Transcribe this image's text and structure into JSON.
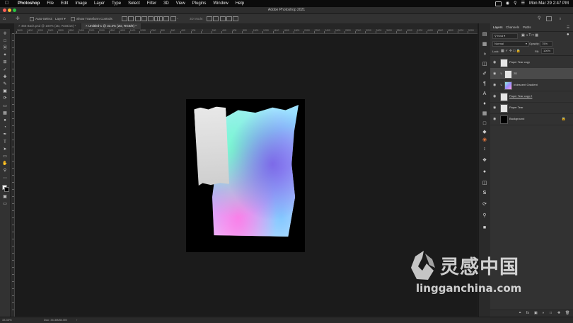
{
  "menubar": {
    "app": "Photoshop",
    "menus": [
      "File",
      "Edit",
      "Image",
      "Layer",
      "Type",
      "Select",
      "Filter",
      "3D",
      "View",
      "Plugins",
      "Window",
      "Help"
    ],
    "clock": "Mon Mar 29  2:47 PM"
  },
  "titlebar": {
    "title": "Adobe Photoshop 2021"
  },
  "options": {
    "auto_select": "Auto-Select:",
    "auto_select_target": "Layer",
    "transform_controls": "Show Transform Controls",
    "mode_3d": "3D Mode:"
  },
  "tabs": [
    {
      "label": "456 Back.psd @ 100% (2D, RGB/16) *"
    },
    {
      "label": "Untitled-1 @ 33.3% (2D, RGB/8) *"
    }
  ],
  "ruler": {
    "labels": [
      "3600",
      "3400",
      "3200",
      "3000",
      "2800",
      "2600",
      "2400",
      "2200",
      "2000",
      "1800",
      "1600",
      "1400",
      "1200",
      "1000",
      "800",
      "600",
      "400",
      "200",
      "0",
      "200",
      "400",
      "600",
      "800",
      "1000",
      "1200",
      "1400",
      "1600",
      "1800",
      "2000",
      "2200",
      "2400",
      "2600",
      "2800",
      "3000",
      "3200",
      "3400",
      "3600",
      "3800",
      "4000",
      "4200",
      "4400",
      "4600",
      "4800",
      "5000",
      "5200",
      "5400"
    ]
  },
  "panel": {
    "tabs": [
      "Layers",
      "Channels",
      "Paths"
    ],
    "kind": "Kind",
    "blend_mode": "Normal",
    "opacity_label": "Opacity:",
    "opacity_value": "75%",
    "lock_label": "Lock:",
    "fill_label": "Fill:",
    "fill_value": "100%",
    "layers": [
      {
        "name": "Paper Tear copy"
      },
      {
        "name": "2D"
      },
      {
        "name": "Iridescent Gradient"
      },
      {
        "name": "Paper Tear copy 2"
      },
      {
        "name": "Paper Tear"
      },
      {
        "name": "Background"
      }
    ]
  },
  "status": {
    "zoom": "33.33%",
    "doc": "Doc: 34.3M/84.0M"
  },
  "watermark": {
    "cn": "灵感中国",
    "url": "lingganchina.com"
  },
  "colors": {
    "app_bg": "#1e1e1e",
    "panel_bg": "#323232",
    "selected_layer": "#4a4a4a",
    "watermark": "#ffffff"
  }
}
